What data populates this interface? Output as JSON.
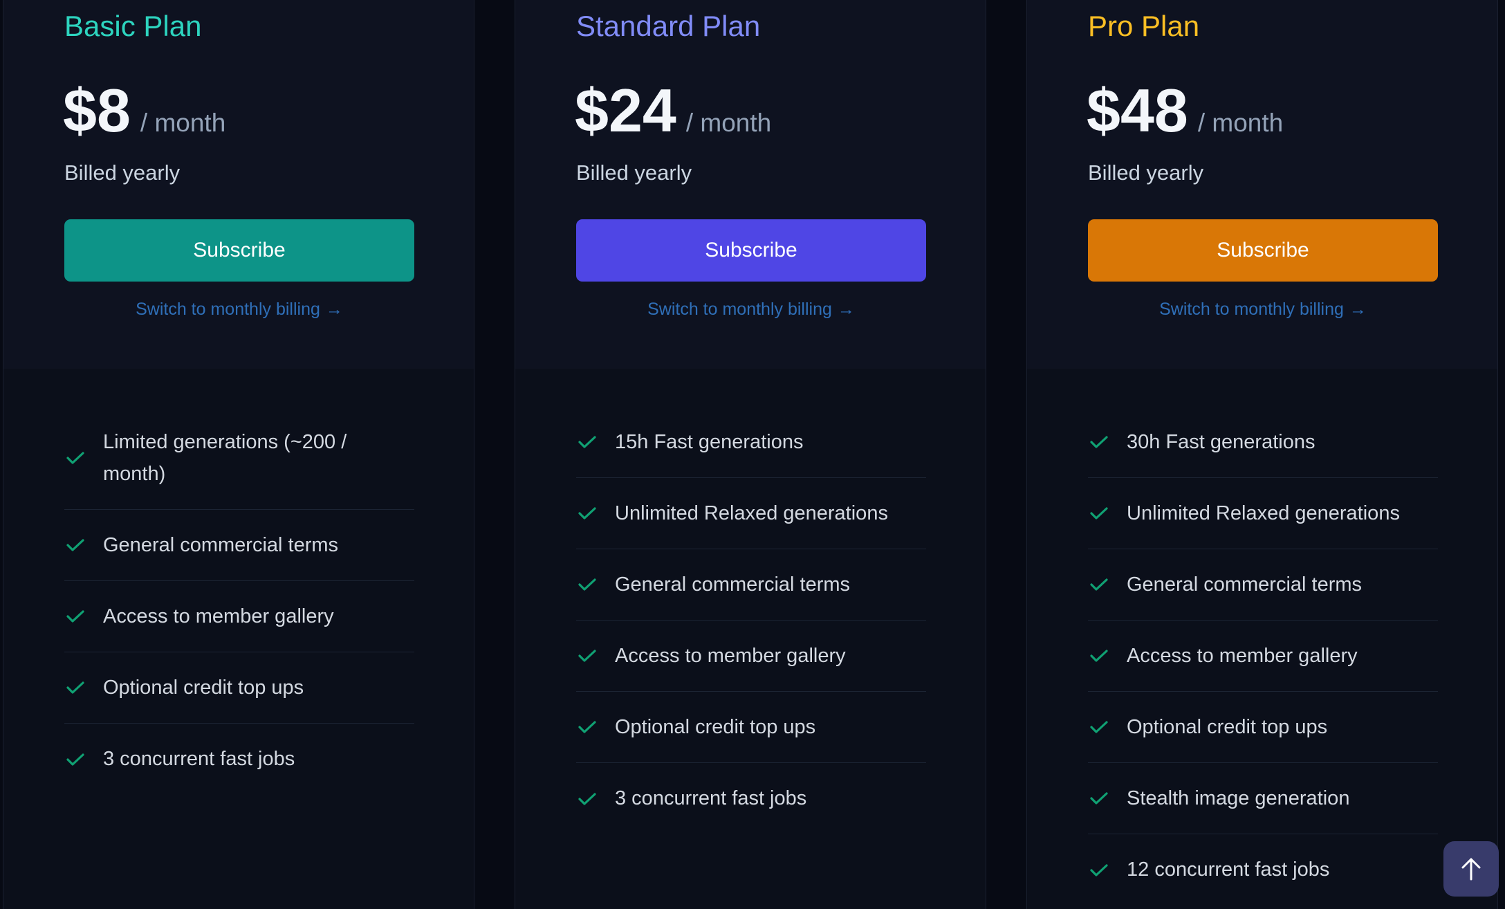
{
  "plans": [
    {
      "name": "Basic Plan",
      "name_color": "#2dd4bf",
      "price": "$8",
      "period": "/ month",
      "billing_note": "Billed yearly",
      "subscribe_label": "Subscribe",
      "button_color": "#0d9488",
      "switch_link": "Switch to monthly billing",
      "features": [
        "Limited generations (~200 / month)",
        "General commercial terms",
        "Access to member gallery",
        "Optional credit top ups",
        "3 concurrent fast jobs"
      ]
    },
    {
      "name": "Standard Plan",
      "name_color": "#818cf8",
      "price": "$24",
      "period": "/ month",
      "billing_note": "Billed yearly",
      "subscribe_label": "Subscribe",
      "button_color": "#4f46e5",
      "switch_link": "Switch to monthly billing",
      "features": [
        "15h Fast generations",
        "Unlimited Relaxed generations",
        "General commercial terms",
        "Access to member gallery",
        "Optional credit top ups",
        "3 concurrent fast jobs"
      ]
    },
    {
      "name": "Pro Plan",
      "name_color": "#fbbf24",
      "price": "$48",
      "period": "/ month",
      "billing_note": "Billed yearly",
      "subscribe_label": "Subscribe",
      "button_color": "#d97706",
      "switch_link": "Switch to monthly billing",
      "features": [
        "30h Fast generations",
        "Unlimited Relaxed generations",
        "General commercial terms",
        "Access to member gallery",
        "Optional credit top ups",
        "Stealth image generation",
        "12 concurrent fast jobs"
      ]
    }
  ],
  "icons": {
    "feature_check": "check-icon",
    "link_arrow": "arrow-right-icon",
    "scroll_top": "arrow-up-icon"
  },
  "colors": {
    "check": "#10a173",
    "link": "#2f6fb8"
  },
  "scroll_top_button": {
    "icon": "arrow-up-icon"
  }
}
